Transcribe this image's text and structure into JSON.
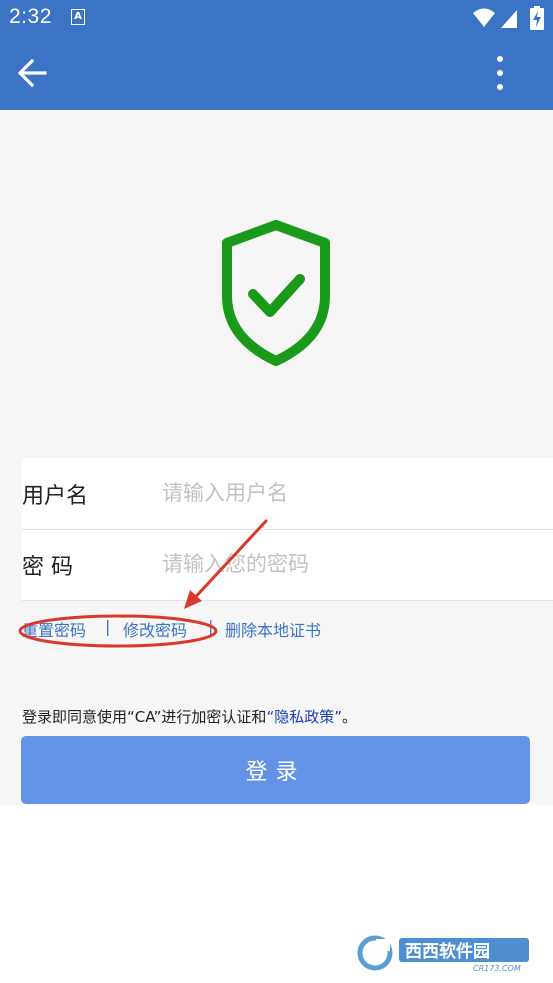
{
  "status_bar": {
    "time": "2:32",
    "notification_icon": "A"
  },
  "app_bar": {
    "back_icon": "arrow-left-icon",
    "more_icon": "more-vertical-icon"
  },
  "form": {
    "username_label": "用户名",
    "username_placeholder": "请输入用户名",
    "password_label": "密 码",
    "password_placeholder": "请输入您的密码"
  },
  "links": {
    "reset_password": "重置密码",
    "separator": "|",
    "change_password": "修改密码",
    "delete_certificate": "删除本地证书"
  },
  "agreement": {
    "prefix": "登录即同意使用“CA”进行加密认证和",
    "privacy_link": "“隐私政策”",
    "suffix": "。"
  },
  "login_button": {
    "label": "登录"
  },
  "watermark": {
    "text": "西西软件园",
    "domain": "CR173.COM"
  },
  "colors": {
    "app_bar": "#3b73c5",
    "shield": "#1a9a1a",
    "link": "#3b73c5",
    "button": "#6393e6",
    "annotation": "#d9392b"
  }
}
